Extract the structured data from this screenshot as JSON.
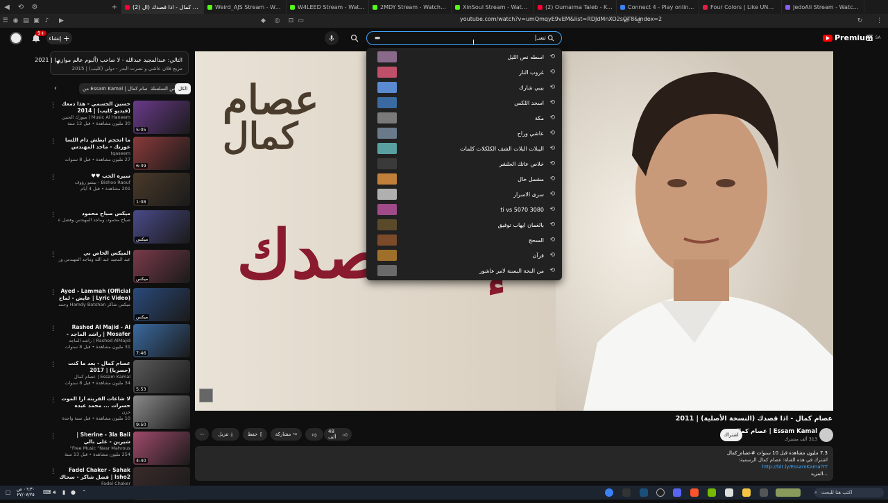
{
  "browser": {
    "tabs": [
      {
        "label": "(2) عصام كمال - اذا قصدك (ال",
        "color": "#ff0033",
        "active": true
      },
      {
        "label": "Weird_AJS Stream - Watch Live on Ki",
        "color": "#53fc18"
      },
      {
        "label": "W4LEED Stream - Watch Live on Kick",
        "color": "#53fc18"
      },
      {
        "label": "2MDY Stream - Watch Live on Kick",
        "color": "#53fc18"
      },
      {
        "label": "XinSoul Stream - Watch Live on Kick",
        "color": "#53fc18"
      },
      {
        "label": "(2) Oumaima Taleb - Koi Leila [lyric V",
        "color": "#ff0033"
      },
      {
        "label": "Connect 4 - Play online game - 2 pla",
        "color": "#3b82f6"
      },
      {
        "label": "Four Colors | Like UNO Online | Play",
        "color": "#e11d48"
      },
      {
        "label": "JedoAli Stream - Watch Live on Kick",
        "color": "#8b5cf6"
      }
    ],
    "url": "youtube.com/watch?v=umQmqyE9vEM&list=RDJdMnXO2sOT8&index=2"
  },
  "header": {
    "create_label": "إنشاء",
    "notif_count": "9+",
    "search_value": "نسـ|",
    "logo_text": "Premium",
    "logo_region": "SA"
  },
  "suggestions": [
    {
      "text": "اسطه نص الليل",
      "color": "#8a6a8a"
    },
    {
      "text": "غروب النار",
      "color": "#c0506a"
    },
    {
      "text": "بيبي شارك",
      "color": "#5a8ad0"
    },
    {
      "text": "اسحد اللكس",
      "color": "#3a6aa0"
    },
    {
      "text": "مكة",
      "color": "#7a7a7a"
    },
    {
      "text": "عاشي وراح",
      "color": "#6a7a8a"
    },
    {
      "text": "اليبلات البلات الشف الكلكلات كلمات",
      "color": "#5aa0a0"
    },
    {
      "text": "خلاص عاتك الحلشر",
      "color": "#3a3a3a"
    },
    {
      "text": "مشمل خال",
      "color": "#c0803a"
    },
    {
      "text": "سرى الاسرار",
      "color": "#b0b0b0"
    },
    {
      "text": "ti vs 5070 3080",
      "color": "#a04a8a"
    },
    {
      "text": "بالغمان ايهاب توفيق",
      "color": "#5a4a2a"
    },
    {
      "text": "السحج",
      "color": "#7a4a2a"
    },
    {
      "text": "قرآن",
      "color": "#a0702a"
    },
    {
      "text": "من البحة البسنة لامر عاشور",
      "color": "#6a6a6a"
    }
  ],
  "playlist": {
    "title": "التالي: عبدالمجيد عبدالله - لا صاحب (ألبوم عالم موازي) | 2021",
    "subtitle": "مزيج فلان عاشي و نصرت البدر - دولي (كليب) | 2015",
    "chips": [
      "الكل",
      "من السلسلة",
      "من Essam Kamal | عصام كمال"
    ]
  },
  "items": [
    {
      "title": "حسين الجسمي - هذا دمعك (فيديو كليب) | 2014",
      "channel": "Music Al Haneem | ميوزك الحنين",
      "meta": "30 مليون مشاهدة • قبل 12 سنة",
      "duration": "5:05",
      "color": "#6a3a8a"
    },
    {
      "title": "ما اتحجم ابطش دام اللسا عوزتك - ماجد المهندس",
      "channel": "tqaseem",
      "meta": "27 مليون مشاهدة • قبل 8 سنوات",
      "duration": "6:39",
      "color": "#8a3a3a"
    },
    {
      "title": "سيرة الحب ♥♥",
      "channel": "Bishoo Raouf - بيشو رؤوف",
      "meta": "201 مشاهدة • قبل 4 أيام",
      "duration": "1:08",
      "color": "#4a3a2a"
    },
    {
      "title": "ميكس صباح محمود",
      "channel": "صباح محمود، وماجد المهندس وفضل عاشي وآخرون",
      "meta": "",
      "duration": "ميكس",
      "color": "#4a4a8a"
    },
    {
      "title": "الميكس الخاص بي",
      "channel": "عبد المجيد عبد الله وماجد المهندس وراشد الماجد وآخرون",
      "meta": "",
      "duration": "ميكس",
      "color": "#7a3a4a"
    },
    {
      "title": "Ayed - Lammah (Official Lyric Video) | عايض - لماح (فيديو كلمات)",
      "channel": "ميكس شاكر Hamdy Batshan وحمدي البتشان",
      "meta": "",
      "duration": "ميكس",
      "color": "#2a4a7a"
    },
    {
      "title": "Rashed Al Majid - Al Mosafer | راشد الماجد - المسافر | 1996",
      "channel": "Rashed AlMajid | راشد الماجد",
      "meta": "31 مليون مشاهدة • قبل 8 سنوات",
      "duration": "7:46",
      "color": "#3a6aa0"
    },
    {
      "title": "عصام كمال - بعد ما كنت (حصريا) | 2017",
      "channel": "Essam Kamal | عصام كمال",
      "meta": "34 مليون مشاهدة • قبل 8 سنوات",
      "duration": "5:53",
      "color": "#5a5a5a"
    },
    {
      "title": "لا شاعات القربته ارا الموت حسرات ... محمد عبده",
      "channel": "حزن",
      "meta": "10 مليون مشاهدة • قبل سنة واحدة",
      "duration": "9:50",
      "color": "#8a8a8a"
    },
    {
      "title": "Sherine - 3la Bali | شيرين - على بالي",
      "channel": "Free Music \"Nasr Mahrous\"",
      "meta": "254 مليون مشاهدة • قبل 13 سنة",
      "duration": "4:40",
      "color": "#a04a6a"
    },
    {
      "title": "Fadel Chaker - Sahak Isho2 | فضل شاكر - سحاك الشوق | 2025",
      "channel": "Fadel Chaker",
      "meta": "",
      "duration": "",
      "color": "#3a2a2a"
    }
  ],
  "player": {
    "overlay_line1": "عصام",
    "overlay_line2": "كمال",
    "overlay_line3": "إذا قصدك"
  },
  "video": {
    "title": "عصام كمال - اذا قصدك (النسخة الأصلية) | 2011",
    "channel": "Essam Kamal | عصام كمال",
    "subs": "313 ألف مشترك",
    "subscribe": "اشتراك",
    "likes": "48 ألف",
    "share": "مشاركة",
    "save": "حفظ",
    "download": "تنزيل",
    "desc_line1": "7.3 مليون مشاهدة قبل 10 سنوات #عصام_كمال",
    "desc_line2": "اشترك في هذه القناة: عصام كمال الرسمية:",
    "desc_link": "http://bit.ly/EssamKamalYT",
    "desc_more": "...المزيد"
  },
  "taskbar": {
    "search_label": "اكتب هنا للبحث",
    "time": "٠٦:٣٠ ص",
    "date": "٢٧/٠٧/٢٥"
  }
}
